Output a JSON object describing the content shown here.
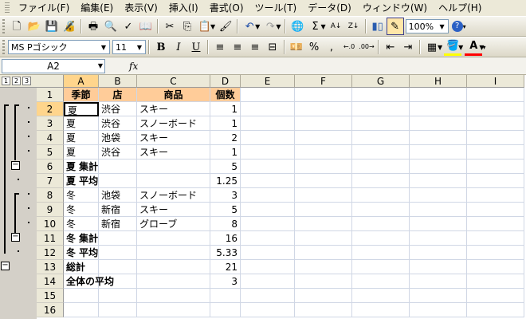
{
  "menu": [
    "ファイル(F)",
    "編集(E)",
    "表示(V)",
    "挿入(I)",
    "書式(O)",
    "ツール(T)",
    "データ(D)",
    "ウィンドウ(W)",
    "ヘルプ(H)"
  ],
  "toolbar": {
    "zoom": "100%",
    "font_name": "MS Pゴシック",
    "font_size": "11",
    "bold": "B",
    "italic": "I",
    "underline": "U",
    "percent": "%",
    "comma": ",",
    "sigma": "Σ",
    "help": "?"
  },
  "formula_bar": {
    "name_box": "A2",
    "fx": "fx"
  },
  "outline_levels": [
    "1",
    "2",
    "3"
  ],
  "columns": [
    "A",
    "B",
    "C",
    "D",
    "E",
    "F",
    "G",
    "H",
    "I"
  ],
  "rows": [
    "1",
    "2",
    "3",
    "4",
    "5",
    "6",
    "7",
    "8",
    "9",
    "10",
    "11",
    "12",
    "13",
    "14",
    "15",
    "16"
  ],
  "cells": [
    [
      {
        "v": "季節",
        "s": "hdr"
      },
      {
        "v": "店",
        "s": "hdr"
      },
      {
        "v": "商品",
        "s": "hdr"
      },
      {
        "v": "個数",
        "s": "hdr"
      }
    ],
    [
      {
        "v": "夏"
      },
      {
        "v": "渋谷"
      },
      {
        "v": "スキー"
      },
      {
        "v": "1",
        "s": "num"
      }
    ],
    [
      {
        "v": "夏"
      },
      {
        "v": "渋谷"
      },
      {
        "v": "スノーボード"
      },
      {
        "v": "1",
        "s": "num"
      }
    ],
    [
      {
        "v": "夏"
      },
      {
        "v": "池袋"
      },
      {
        "v": "スキー"
      },
      {
        "v": "2",
        "s": "num"
      }
    ],
    [
      {
        "v": "夏"
      },
      {
        "v": "渋谷"
      },
      {
        "v": "スキー"
      },
      {
        "v": "1",
        "s": "num"
      }
    ],
    [
      {
        "v": "夏 集計",
        "s": "bold"
      },
      {
        "v": ""
      },
      {
        "v": ""
      },
      {
        "v": "5",
        "s": "num"
      }
    ],
    [
      {
        "v": "夏 平均",
        "s": "bold"
      },
      {
        "v": ""
      },
      {
        "v": ""
      },
      {
        "v": "1.25",
        "s": "num"
      }
    ],
    [
      {
        "v": "冬"
      },
      {
        "v": "池袋"
      },
      {
        "v": "スノーボード"
      },
      {
        "v": "3",
        "s": "num"
      }
    ],
    [
      {
        "v": "冬"
      },
      {
        "v": "新宿"
      },
      {
        "v": "スキー"
      },
      {
        "v": "5",
        "s": "num"
      }
    ],
    [
      {
        "v": "冬"
      },
      {
        "v": "新宿"
      },
      {
        "v": "グローブ"
      },
      {
        "v": "8",
        "s": "num"
      }
    ],
    [
      {
        "v": "冬 集計",
        "s": "bold"
      },
      {
        "v": ""
      },
      {
        "v": ""
      },
      {
        "v": "16",
        "s": "num"
      }
    ],
    [
      {
        "v": "冬 平均",
        "s": "bold"
      },
      {
        "v": ""
      },
      {
        "v": ""
      },
      {
        "v": "5.33",
        "s": "num"
      }
    ],
    [
      {
        "v": "総計",
        "s": "bold"
      },
      {
        "v": ""
      },
      {
        "v": ""
      },
      {
        "v": "21",
        "s": "num"
      }
    ],
    [
      {
        "v": "全体の平均",
        "s": "bold"
      },
      {
        "v": ""
      },
      {
        "v": ""
      },
      {
        "v": "3",
        "s": "num"
      }
    ],
    [],
    []
  ],
  "active_cell": "A2",
  "colors": {
    "header_fill": "#ffcc99",
    "selected_header": "#ffd58c",
    "chrome": "#ece9d8"
  }
}
